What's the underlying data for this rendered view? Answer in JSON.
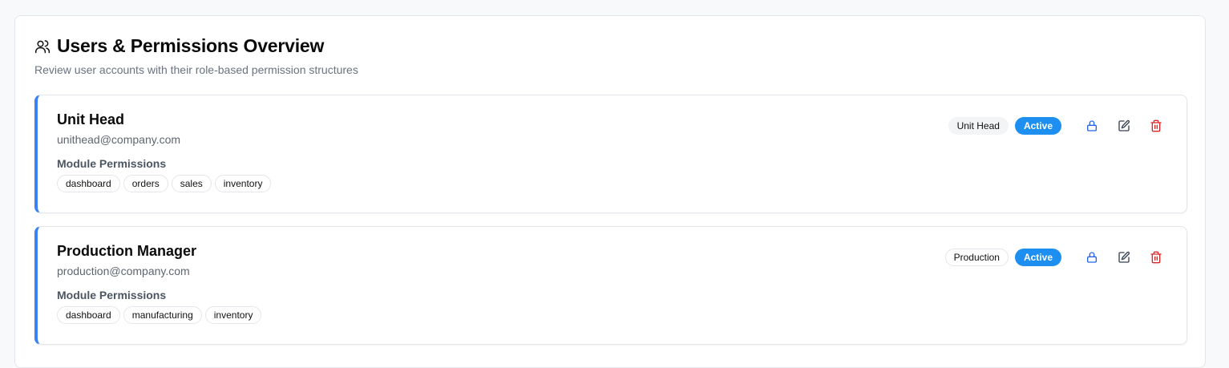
{
  "header": {
    "title": "Users & Permissions Overview",
    "subtitle": "Review user accounts with their role-based permission structures",
    "icon": "users-icon"
  },
  "permissions_label": "Module Permissions",
  "colors": {
    "accent": "#3b82f6",
    "status_active": "#1d8ff0",
    "delete": "#dc2626",
    "lock": "#2563eb"
  },
  "users": [
    {
      "name": "Unit Head",
      "email": "unithead@company.com",
      "role": "Unit Head",
      "status": "Active",
      "permissions": [
        "dashboard",
        "orders",
        "sales",
        "inventory"
      ]
    },
    {
      "name": "Production Manager",
      "email": "production@company.com",
      "role": "Production",
      "status": "Active",
      "permissions": [
        "dashboard",
        "manufacturing",
        "inventory"
      ]
    }
  ]
}
